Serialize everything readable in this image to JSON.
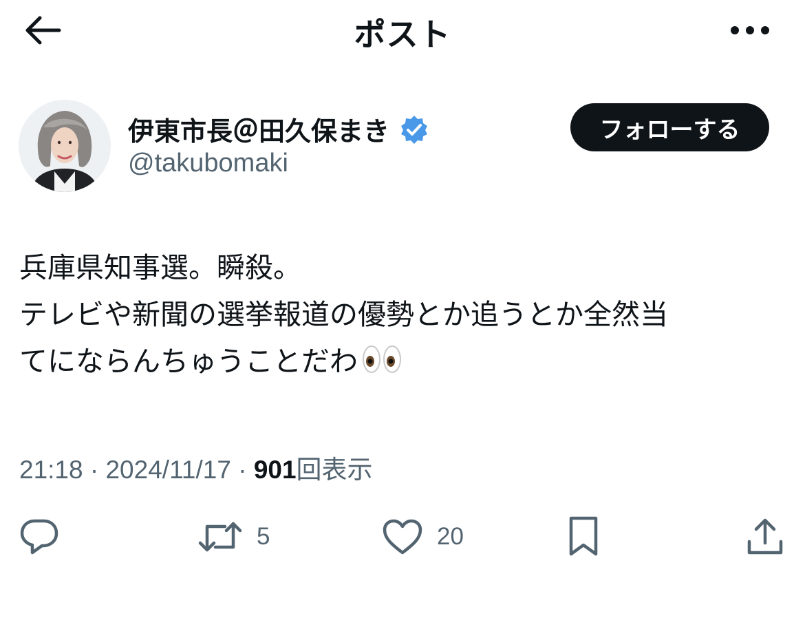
{
  "header": {
    "title": "ポスト",
    "back_icon": "arrow-left-icon",
    "more_icon": "more-horizontal-icon"
  },
  "author": {
    "display_name": "伊東市長＠田久保まき",
    "handle": "@takubomaki",
    "verified": true,
    "verified_color": "#4a99e9",
    "follow_label": "フォローする"
  },
  "tweet": {
    "lines": [
      "兵庫県知事選。瞬殺。",
      "テレビや新聞の選挙報道の優勢とか追うとか全然当",
      "てにならんちゅうことだわ"
    ],
    "emoji": "eyes-emoji"
  },
  "meta": {
    "time": "21:18",
    "separator": "·",
    "date": "2024/11/17",
    "views_count": "901",
    "views_label": "回表示"
  },
  "actions": {
    "reply_count": "",
    "retweet_count": "5",
    "like_count": "20",
    "icon_color": "#536471"
  }
}
